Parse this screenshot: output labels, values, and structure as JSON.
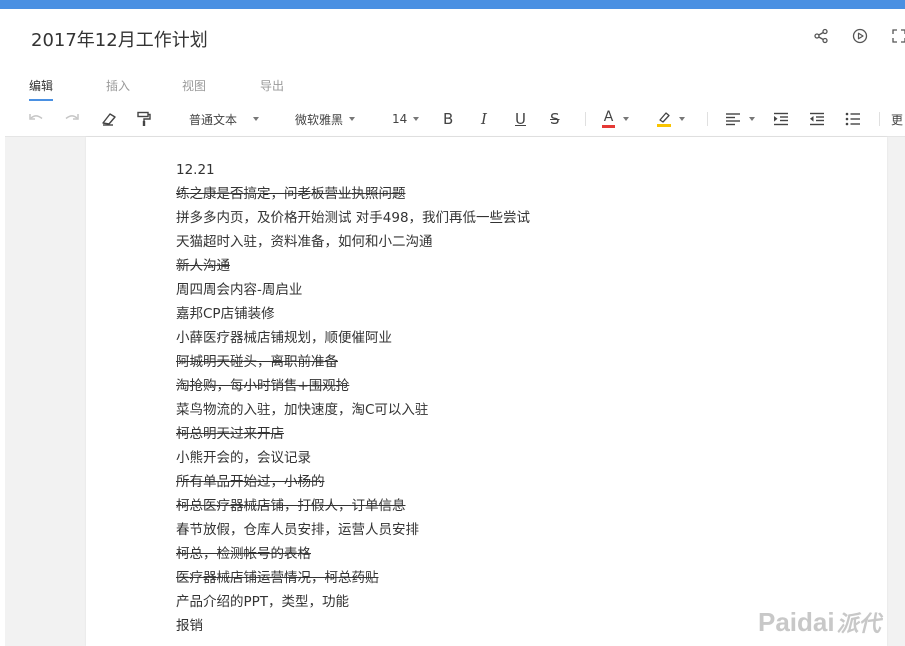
{
  "document": {
    "title": "2017年12月工作计划"
  },
  "header_actions": [
    {
      "name": "share-icon"
    },
    {
      "name": "play-icon"
    },
    {
      "name": "fullscreen-icon"
    }
  ],
  "tabs": [
    {
      "label": "编辑",
      "active": true
    },
    {
      "label": "插入",
      "active": false
    },
    {
      "label": "视图",
      "active": false
    },
    {
      "label": "导出",
      "active": false
    }
  ],
  "toolbar": {
    "paragraph_style": "普通文本",
    "font_family": "微软雅黑",
    "font_size": "14",
    "bold_label": "B",
    "italic_label": "I",
    "underline_label": "U",
    "strike_label": "S",
    "font_color_label": "A",
    "font_color": "#e53935",
    "highlight_color": "#f9c400",
    "more_label": "更"
  },
  "content": {
    "lines": [
      {
        "text": "12.21",
        "struck": false
      },
      {
        "text": "练之康是否搞定，问老板营业执照问题",
        "struck": true
      },
      {
        "text": "拼多多内页，及价格开始测试 对手498，我们再低一些尝试",
        "struck": false
      },
      {
        "text": "天猫超时入驻，资料准备，如何和小二沟通",
        "struck": false
      },
      {
        "text": "新人沟通",
        "struck": true
      },
      {
        "text": "周四周会内容-周启业",
        "struck": false
      },
      {
        "text": "嘉邦CP店铺装修",
        "struck": false
      },
      {
        "text": "小薛医疗器械店铺规划，顺便催阿业",
        "struck": false
      },
      {
        "text": "阿城明天碰头，离职前准备",
        "struck": true
      },
      {
        "text": "淘抢购，每小时销售+围观抢",
        "struck": true
      },
      {
        "text": "菜鸟物流的入驻，加快速度，淘C可以入驻",
        "struck": false
      },
      {
        "text": "柯总明天过来开店",
        "struck": true
      },
      {
        "text": "小熊开会的，会议记录",
        "struck": false
      },
      {
        "text": "所有单品开始过，小杨的",
        "struck": true
      },
      {
        "text": "柯总医疗器械店铺，打假人，订单信息",
        "struck": true
      },
      {
        "text": "春节放假，仓库人员安排，运营人员安排",
        "struck": false
      },
      {
        "text": "柯总，检测帐号的表格",
        "struck": true
      },
      {
        "text": "医疗器械店铺运营情况，柯总药贴",
        "struck": true
      },
      {
        "text": "产品介绍的PPT，类型，功能",
        "struck": false
      },
      {
        "text": "报销",
        "struck": false
      }
    ]
  },
  "watermark": {
    "brand": "Paidai",
    "cn": "派代"
  }
}
